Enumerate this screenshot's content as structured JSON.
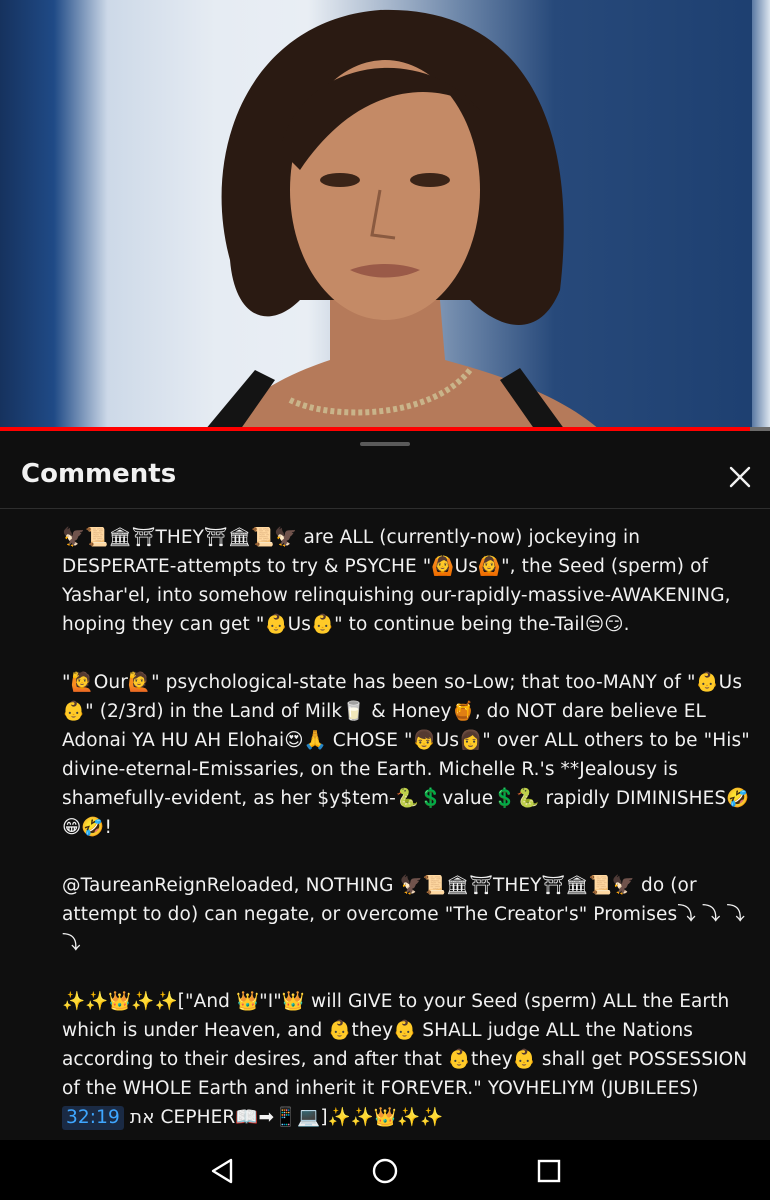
{
  "comments_panel": {
    "title": "Comments",
    "comment": {
      "p1": "🦅📜🏛⛩THEY⛩🏛📜🦅 are ALL (currently-now) jockeying in DESPERATE-attempts to try & PSYCHE \"🙆Us🙆\", the Seed (sperm) of Yashar'el, into somehow relinquishing our-rapidly-massive-AWAKENING, hoping they can get \"👶Us👶\" to continue being the-Tail😒😏.",
      "p2": "\"🙋Our🙋\" psychological-state has been so-Low; that too-MANY of \"👶Us 👶\" (2/3rd) in the Land of Milk🥛 & Honey🍯, do NOT dare believe EL Adonai YA HU AH Elohai😍🙏 CHOSE \"👦Us👩\" over ALL others to be \"His\" divine-eternal-Emissaries, on the Earth. Michelle R.'s **Jealousy is shamefully-evident, as her $y$tem-🐍💲value💲🐍 rapidly DIMINISHES🤣😁🤣!",
      "p3": "@TaureanReignReloaded, NOTHING 🦅📜🏛⛩THEY⛩🏛📜🦅 do (or attempt to do) can negate, or overcome \"The Creator's\" Promises⤵ ⤵ ⤵ ⤵",
      "p4_before": "✨✨👑✨✨[\"And 👑\"I\"👑 will GIVE to your Seed (sperm) ALL the Earth which is under Heaven, and 👶they👶 SHALL judge ALL the Nations according to their desires, and after that 👶they👶 shall get POSSESSION of the WHOLE Earth and inherit it FOREVER.\"   YOVHELIYM (JUBILEES) ",
      "timestamp": "32:19",
      "p4_after": " את CEPHER📖➡📱💻]✨✨👑✨✨"
    }
  },
  "video": {
    "progress_fraction": 0.974
  },
  "colors": {
    "progress": "#ff0000",
    "timestamp_link": "#3ea6ff",
    "background": "#0f0f0f"
  },
  "icons": [
    "close-icon",
    "back-icon",
    "home-icon",
    "recents-icon"
  ]
}
